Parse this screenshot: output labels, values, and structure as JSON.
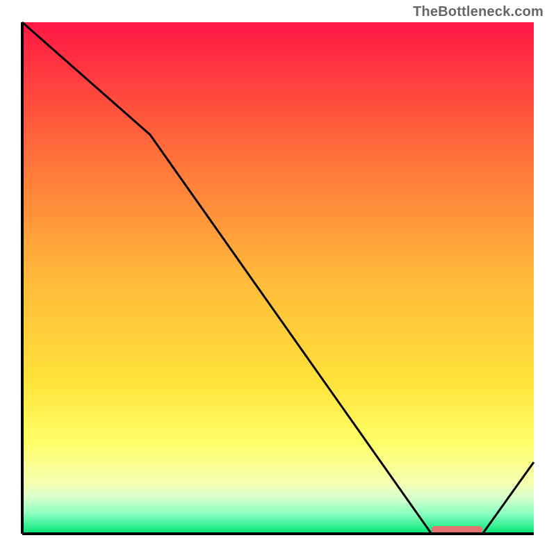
{
  "attribution": "TheBottleneck.com",
  "chart_data": {
    "type": "line",
    "title": "",
    "xlabel": "",
    "ylabel": "",
    "xlim": [
      0,
      100
    ],
    "ylim": [
      0,
      100
    ],
    "x": [
      0,
      25,
      80,
      90,
      100
    ],
    "y": [
      100,
      78,
      0,
      0,
      14
    ],
    "optimum_marker": {
      "x_start": 80,
      "x_end": 90
    },
    "gradient_stops": [
      {
        "offset": 0.0,
        "color": "#ff1744"
      },
      {
        "offset": 0.25,
        "color": "#ff6d3a"
      },
      {
        "offset": 0.5,
        "color": "#ffb93a"
      },
      {
        "offset": 0.7,
        "color": "#ffe23a"
      },
      {
        "offset": 0.82,
        "color": "#ffff66"
      },
      {
        "offset": 0.9,
        "color": "#f5ffb0"
      },
      {
        "offset": 0.93,
        "color": "#d6ffcc"
      },
      {
        "offset": 0.96,
        "color": "#8cffc0"
      },
      {
        "offset": 1.0,
        "color": "#00e676"
      }
    ],
    "line_color": "#000000",
    "line_width": 3,
    "axis_color": "#000000",
    "axis_width": 4,
    "marker_color": "#e57373"
  }
}
